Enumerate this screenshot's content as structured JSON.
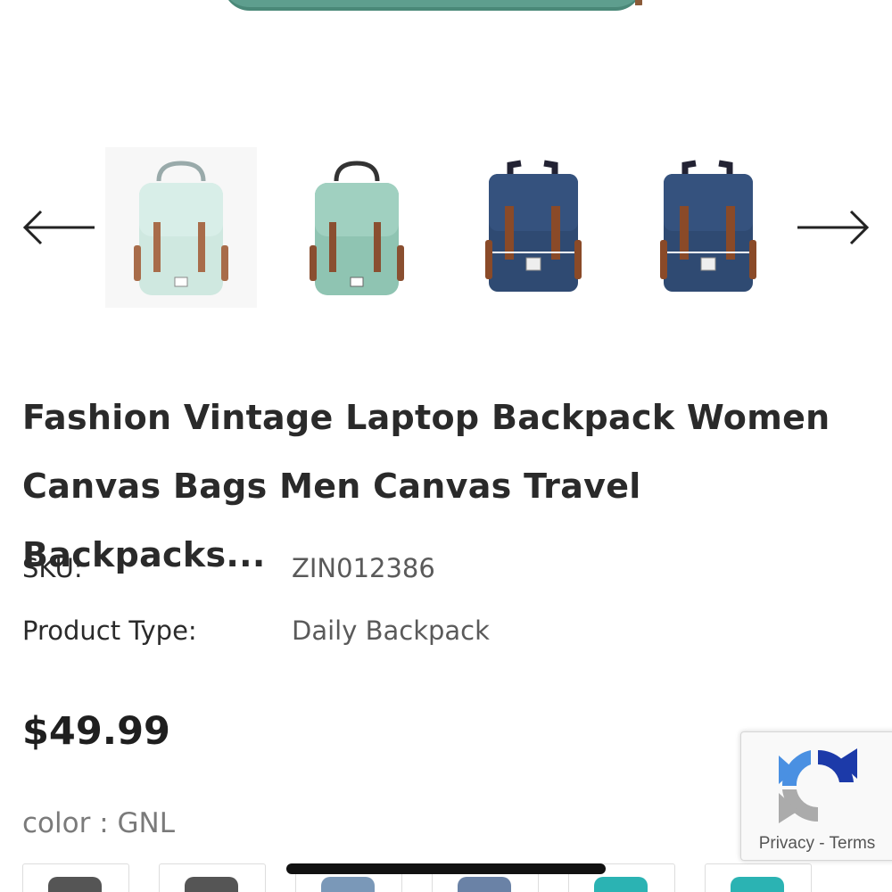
{
  "product": {
    "title": "Fashion Vintage Laptop Backpack Women Canvas Bags Men Canvas Travel Backpacks...",
    "sku_label": "SKU:",
    "sku_value": "ZIN012386",
    "type_label": "Product Type:",
    "type_value": "Daily Backpack",
    "price": "$49.99",
    "color_label": "color : GNL"
  },
  "carousel": {
    "prev_icon": "arrow-left-icon",
    "next_icon": "arrow-right-icon",
    "thumbnails": [
      {
        "name": "light-mint-backpack",
        "body": "#cfe8e0",
        "strap": "#a86c4a"
      },
      {
        "name": "mint-green-backpack",
        "body": "#8fc4b2",
        "strap": "#8a4f30"
      },
      {
        "name": "navy-blue-backpack",
        "body": "#2f4a72",
        "strap": "#8a4a28"
      },
      {
        "name": "navy-blue-backpack-alt",
        "body": "#2f4a72",
        "strap": "#8a4a28"
      }
    ]
  },
  "swatches": [
    {
      "color": "#555555"
    },
    {
      "color": "#555555"
    },
    {
      "color": "#7a98b8"
    },
    {
      "color": "#6a82a6"
    },
    {
      "color": "#2bb3b3"
    },
    {
      "color": "#2bb3b3"
    }
  ],
  "recaptcha": {
    "privacy": "Privacy",
    "separator": "-",
    "terms": "Terms"
  }
}
